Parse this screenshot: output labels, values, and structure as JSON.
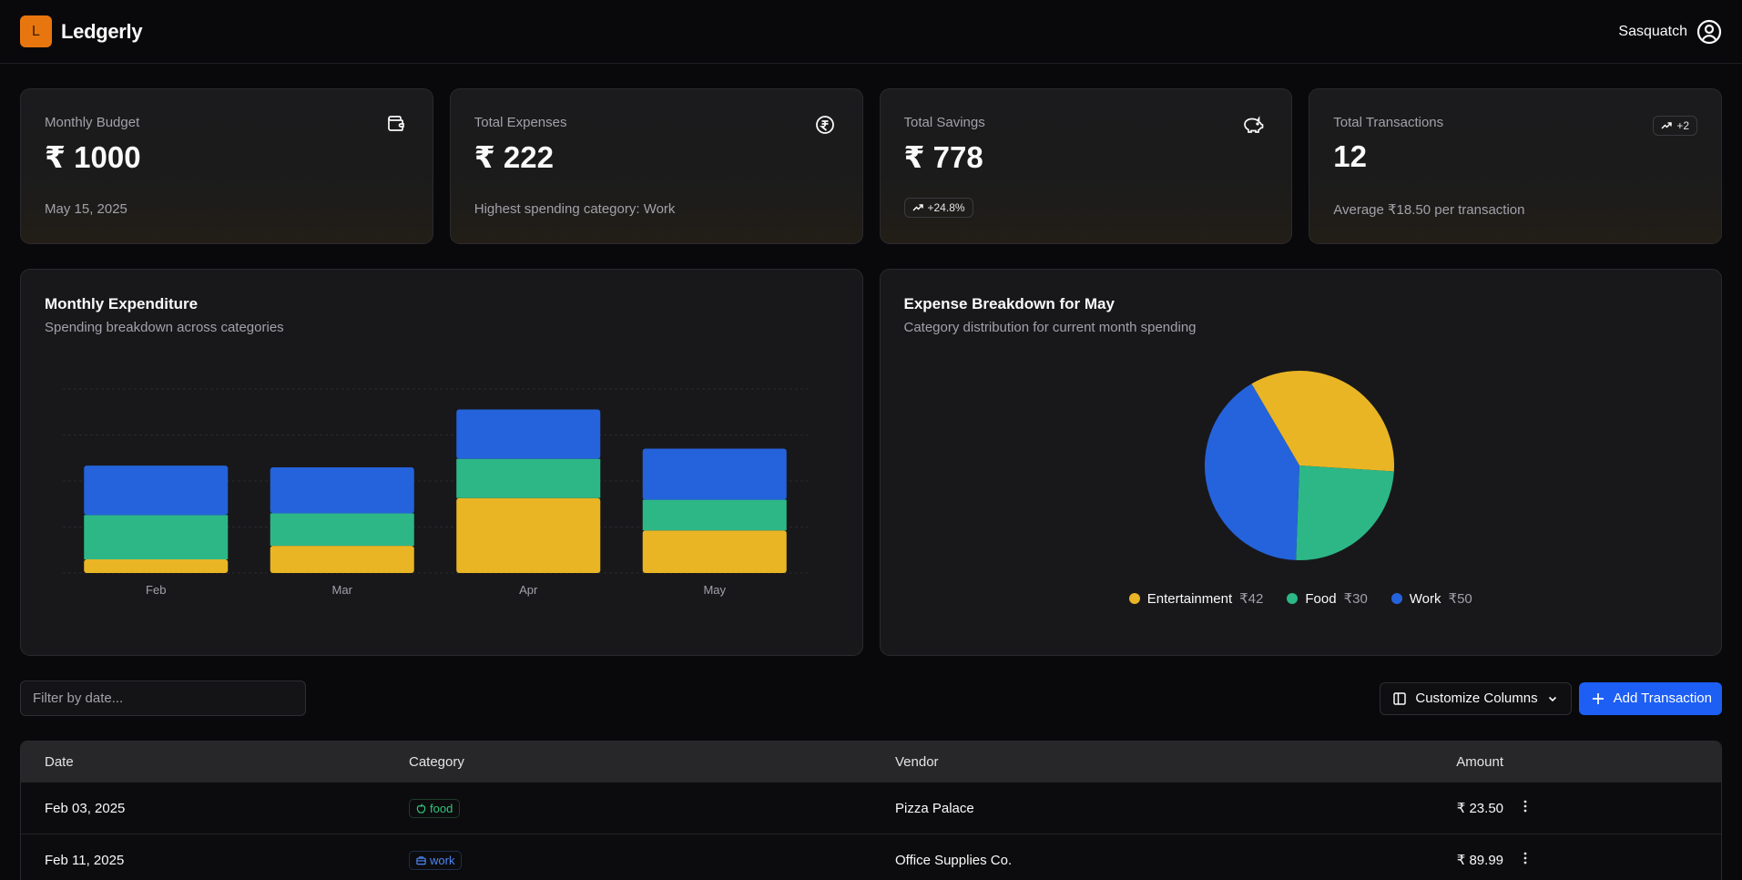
{
  "app": {
    "logo_letter": "L",
    "name": "Ledgerly"
  },
  "user": {
    "name": "Sasquatch"
  },
  "colors": {
    "accent": "#e8760f",
    "primary": "#1d5ff5",
    "entertainment": "#e9b525",
    "food": "#2db787",
    "work": "#2563dc"
  },
  "cards": [
    {
      "label": "Monthly Budget",
      "value": "₹ 1000",
      "foot": "May 15, 2025",
      "icon": "wallet-icon"
    },
    {
      "label": "Total Expenses",
      "value": "₹ 222",
      "foot": "Highest spending category: Work",
      "icon": "rupee-circle-icon"
    },
    {
      "label": "Total Savings",
      "value": "₹ 778",
      "foot_badge": "+24.8%",
      "icon": "piggy-bank-icon"
    },
    {
      "label": "Total Transactions",
      "value": "12",
      "badge": "+2",
      "foot": "Average ₹18.50 per transaction",
      "icon": "trending-up-icon"
    }
  ],
  "bar_panel": {
    "title": "Monthly Expenditure",
    "subtitle": "Spending breakdown across categories"
  },
  "pie_panel": {
    "title": "Expense Breakdown for May",
    "subtitle": "Category distribution for current month spending"
  },
  "chart_data": [
    {
      "type": "bar",
      "stacked": true,
      "categories": [
        "Feb",
        "Mar",
        "Apr",
        "May"
      ],
      "series": [
        {
          "name": "Entertainment",
          "color": "#e9b525",
          "values": [
            8,
            16,
            44,
            25
          ]
        },
        {
          "name": "Food",
          "color": "#2db787",
          "values": [
            26,
            19,
            23,
            18
          ]
        },
        {
          "name": "Work",
          "color": "#2563dc",
          "values": [
            29,
            27,
            29,
            30
          ]
        }
      ],
      "ylim": [
        0,
        108
      ],
      "grid": true,
      "legend": "none"
    },
    {
      "type": "pie",
      "slices": [
        {
          "label": "Entertainment",
          "value": 42,
          "display": "₹42",
          "color": "#e9b525"
        },
        {
          "label": "Food",
          "value": 30,
          "display": "₹30",
          "color": "#2db787"
        },
        {
          "label": "Work",
          "value": 50,
          "display": "₹50",
          "color": "#2563dc"
        }
      ],
      "legend": "bottom"
    }
  ],
  "toolbar": {
    "filter_placeholder": "Filter by date...",
    "columns_label": "Customize Columns",
    "add_label": "Add Transaction"
  },
  "table": {
    "headers": [
      "Date",
      "Category",
      "Vendor",
      "Amount"
    ],
    "rows": [
      {
        "date": "Feb 03, 2025",
        "category": "food",
        "vendor": "Pizza Palace",
        "amount": "₹ 23.50"
      },
      {
        "date": "Feb 11, 2025",
        "category": "work",
        "vendor": "Office Supplies Co.",
        "amount": "₹ 89.99"
      }
    ]
  }
}
